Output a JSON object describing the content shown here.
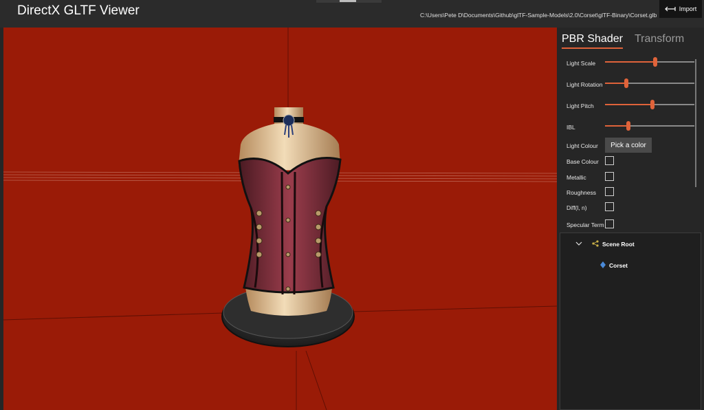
{
  "app": {
    "title": "DirectX GLTF Viewer",
    "file_path": "C:\\Users\\Pete D\\Documents\\Github\\glTF-Sample-Models\\2.0\\Corset\\glTF-Binary\\Corset.glb"
  },
  "toolbar": {
    "import_label": "Import",
    "import_icon": "arrow-left-icon"
  },
  "tabs": [
    {
      "label": "PBR Shader",
      "active": true
    },
    {
      "label": "Transform",
      "active": false
    }
  ],
  "shader": {
    "sliders": [
      {
        "label": "Light Scale",
        "value": 0.56
      },
      {
        "label": "Light Rotation",
        "value": 0.24
      },
      {
        "label": "Light Pitch",
        "value": 0.53
      },
      {
        "label": "IBL",
        "value": 0.26
      }
    ],
    "light_colour": {
      "label": "Light Colour",
      "button_label": "Pick a color"
    },
    "checkboxes": [
      {
        "label": "Base Colour",
        "checked": false
      },
      {
        "label": "Metallic",
        "checked": false
      },
      {
        "label": "Roughness",
        "checked": false
      },
      {
        "label": "Diff(l, n)",
        "checked": false
      },
      {
        "label": "Specular Term",
        "checked": false
      }
    ]
  },
  "scene_tree": {
    "root": {
      "label": "Scene Root",
      "expanded": true,
      "icon": "hierarchy-icon"
    },
    "children": [
      {
        "label": "Corset",
        "icon": "node-diamond-icon"
      }
    ]
  },
  "colors": {
    "accent": "#e0633a",
    "viewport_background": "#9a1b07",
    "panel_background": "#262626"
  }
}
